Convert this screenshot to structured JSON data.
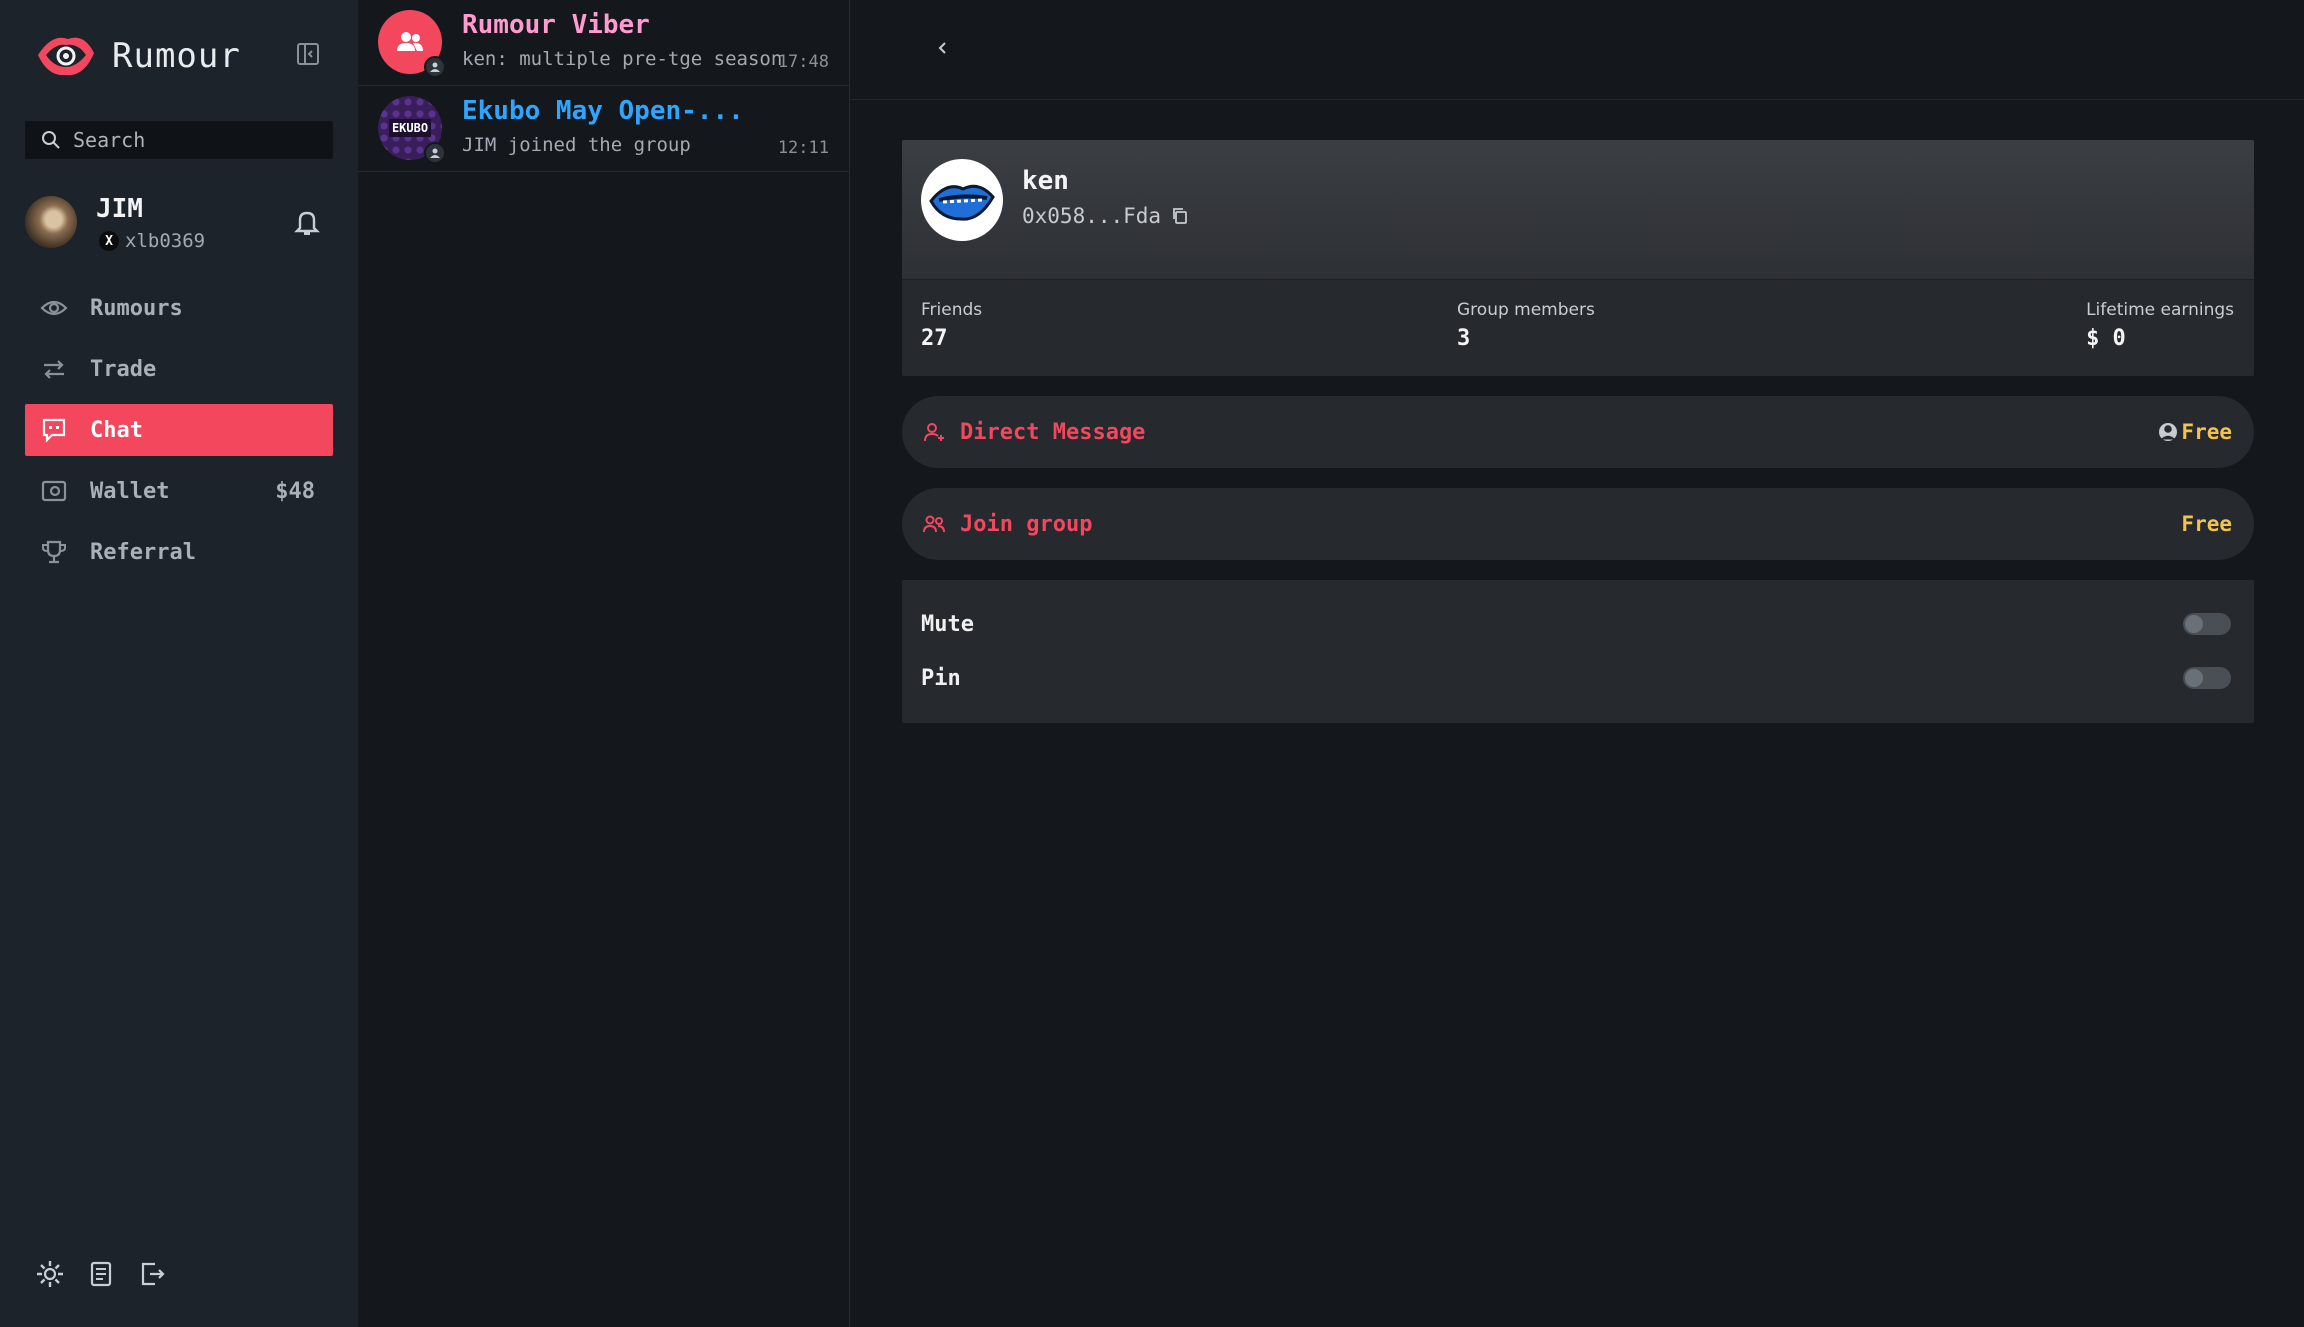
{
  "sidebar": {
    "brand_name": "Rumour",
    "search_placeholder": "Search",
    "user": {
      "name": "JIM",
      "handle": "xlb0369"
    },
    "nav": [
      {
        "label": "Rumours",
        "icon": "eye-icon",
        "active": false
      },
      {
        "label": "Trade",
        "icon": "swap-icon",
        "active": false
      },
      {
        "label": "Chat",
        "icon": "chat-icon",
        "active": true
      },
      {
        "label": "Wallet",
        "icon": "wallet-icon",
        "active": false,
        "value": "$48"
      },
      {
        "label": "Referral",
        "icon": "trophy-icon",
        "active": false
      }
    ],
    "footer_icons": [
      "settings-icon",
      "docs-icon",
      "logout-icon"
    ]
  },
  "chats": [
    {
      "title": "Rumour Viber",
      "preview": "ken: multiple pre-tge season...",
      "time": "17:48",
      "avatar": "group-icon"
    },
    {
      "title": "Ekubo May Open-...",
      "preview": "JIM joined the group",
      "time": "12:11",
      "avatar": "ekubo-logo",
      "avatar_text": "EKUBO"
    }
  ],
  "profile": {
    "name": "ken",
    "address": "0x058...Fda",
    "stats": {
      "friends_label": "Friends",
      "friends_value": "27",
      "members_label": "Group members",
      "members_value": "3",
      "earnings_label": "Lifetime earnings",
      "earnings_value": "$ 0"
    }
  },
  "actions": {
    "dm_label": "Direct Message",
    "dm_price": "Free",
    "join_label": "Join group",
    "join_price": "Free"
  },
  "settings": {
    "mute_label": "Mute",
    "pin_label": "Pin",
    "mute_on": false,
    "pin_on": false
  },
  "colors": {
    "accent": "#f3475e",
    "price": "#f5c24a",
    "sidebar_bg": "#1c232b",
    "page_bg": "#14171b",
    "card_bg": "#26292e"
  }
}
